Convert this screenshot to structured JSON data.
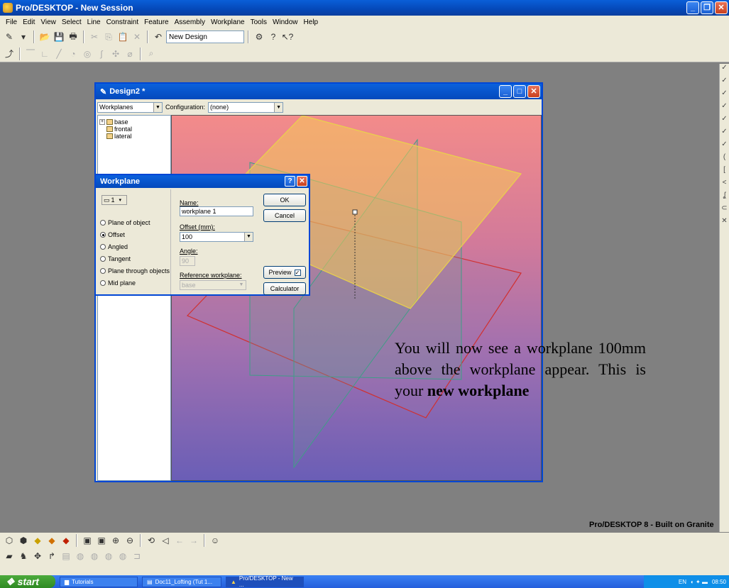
{
  "app": {
    "title": "Pro/DESKTOP - New Session",
    "menu": [
      "File",
      "Edit",
      "View",
      "Select",
      "Line",
      "Constraint",
      "Feature",
      "Assembly",
      "Workplane",
      "Tools",
      "Window",
      "Help"
    ],
    "toolbar_combo": "New Design",
    "brand": "Pro/DESKTOP 8 - Built on Granite"
  },
  "design_window": {
    "title": "Design2 *",
    "browser_combo": "Workplanes",
    "configuration_label": "Configuration:",
    "configuration_value": "(none)",
    "tree": [
      "base",
      "frontal",
      "lateral"
    ]
  },
  "workplane_dialog": {
    "title": "Workplane",
    "selector_value": "1",
    "options": [
      "Plane of object",
      "Offset",
      "Angled",
      "Tangent",
      "Plane through objects",
      "Mid plane"
    ],
    "selected_option": "Offset",
    "name_label": "Name:",
    "name_value": "workplane 1",
    "offset_label": "Offset (mm):",
    "offset_value": "100",
    "angle_label": "Angle:",
    "angle_value": "90",
    "reference_label": "Reference workplane:",
    "reference_value": "base",
    "ok_label": "OK",
    "cancel_label": "Cancel",
    "preview_label": "Preview",
    "preview_checked": true,
    "calculator_label": "Calculator"
  },
  "annotation": {
    "text": "You will now see a workplane 100mm above the workplane appear. This is your",
    "bold_text": "new workplane"
  },
  "taskbar": {
    "start_label": "start",
    "tasks": [
      "Tutorials",
      "Doc11_Lofting (Tut 1...",
      "Pro/DESKTOP - New ..."
    ],
    "language": "EN",
    "clock": "08:50"
  },
  "colors": {
    "titlebar_blue": "#0548b8",
    "viewport_top": "#f38b8a",
    "viewport_bottom": "#6a5eb6",
    "plane_yellow": "#f6c85a",
    "plane_green": "#4aa08a",
    "plane_red": "#d03030"
  }
}
